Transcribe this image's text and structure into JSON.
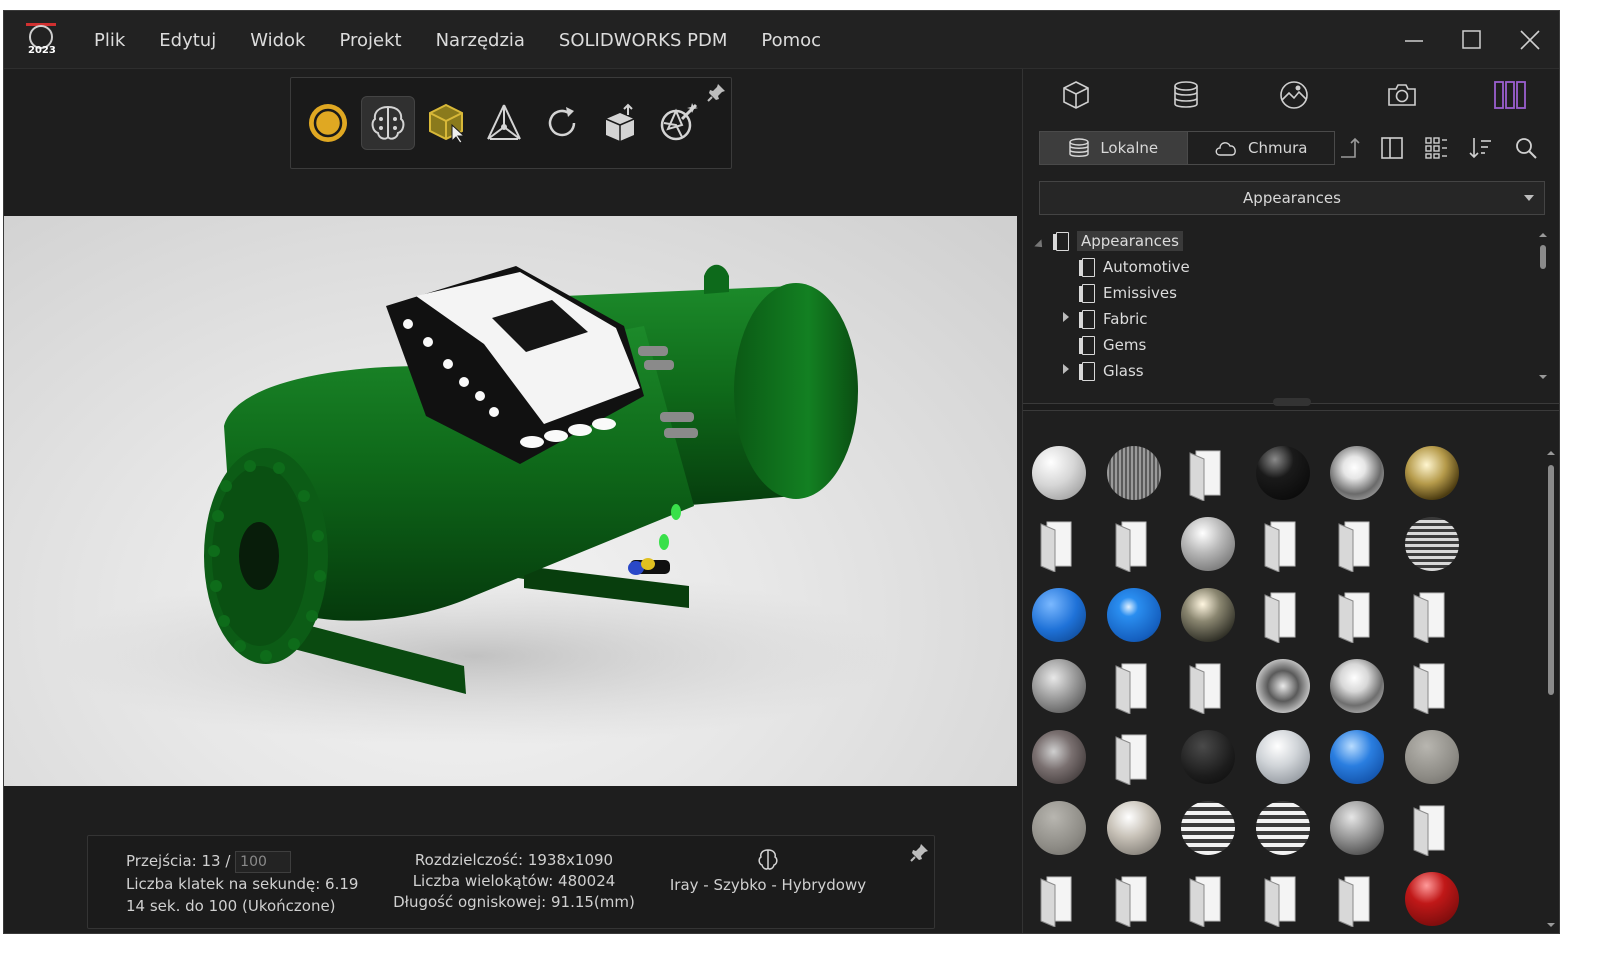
{
  "app": {
    "logo_year": "2023",
    "menu": [
      "Plik",
      "Edytuj",
      "Widok",
      "Projekt",
      "Narzędzia",
      "SOLIDWORKS PDM",
      "Pomoc"
    ]
  },
  "toolbar": {
    "tools": [
      "render-mode-icon",
      "denoiser-brain-icon",
      "select-model-icon",
      "move-gizmo-icon",
      "refresh-icon",
      "box-export-icon",
      "camera-magic-icon"
    ]
  },
  "status": {
    "passes_label": "Przejścia: 13 /",
    "passes_target": "100",
    "fps": "Liczba klatek na sekundę: 6.19",
    "remaining": "14 sek. do 100 (Ukończone)",
    "resolution": "Rozdzielczość: 1938x1090",
    "polygons": "Liczba wielokątów: 480024",
    "focal": "Długość ogniskowej: 91.15(mm)",
    "renderer": "Iray - Szybko - Hybrydowy"
  },
  "panel": {
    "tabs": [
      "model-cube-icon",
      "appearances-cylinder-icon",
      "environment-scene-icon",
      "camera-icon",
      "library-columns-icon"
    ],
    "source_local": "Lokalne",
    "source_cloud": "Chmura",
    "library": "Appearances",
    "tree": [
      {
        "label": "Appearances",
        "level": 0,
        "expandable": true,
        "selected": true
      },
      {
        "label": "Automotive",
        "level": 1,
        "expandable": false
      },
      {
        "label": "Emissives",
        "level": 1,
        "expandable": false
      },
      {
        "label": "Fabric",
        "level": 1,
        "expandable": true
      },
      {
        "label": "Gems",
        "level": 1,
        "expandable": false
      },
      {
        "label": "Glass",
        "level": 1,
        "expandable": true
      }
    ],
    "swatch_rows": [
      [
        "matte-white",
        "brushed-metal",
        "folder",
        "black-gloss",
        "chrome-bright",
        "gold-chrome"
      ],
      [
        "folder",
        "folder",
        "satin-silver",
        "folder",
        "folder",
        "striped-metal"
      ],
      [
        "blue-plastic",
        "blue-gloss",
        "dark-pearl",
        "folder",
        "folder",
        "folder"
      ],
      [
        "brushed-steel",
        "folder",
        "folder",
        "chrome-dark",
        "chrome-light",
        "folder"
      ],
      [
        "smoked-glass",
        "folder",
        "dark-rubber",
        "frosted-glass",
        "blue-glass",
        "grey-matte"
      ],
      [
        "grey-matte",
        "pearl-silver",
        "ribbed-chrome",
        "ribbed-chrome",
        "granite",
        "folder"
      ],
      [
        "folder",
        "folder",
        "folder",
        "folder",
        "folder",
        "red-gloss"
      ]
    ]
  },
  "colors": {
    "background": "#1e1e1e",
    "accent_purple": "#9b5fd0",
    "gold": "#e0b030",
    "model_green": "#0f6a1a"
  }
}
